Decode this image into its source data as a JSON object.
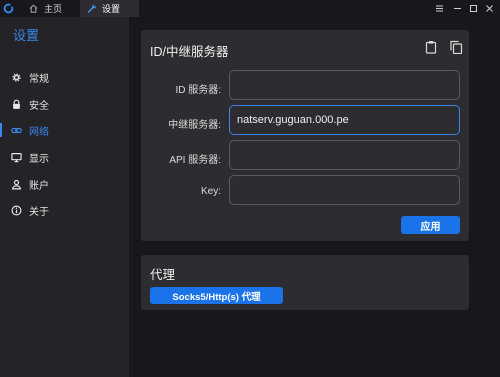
{
  "titlebar": {
    "logo_icon": "app-logo-icon",
    "tabs": [
      {
        "label": "主页",
        "icon": "home-icon"
      },
      {
        "label": "设置",
        "icon": "wrench-icon"
      }
    ],
    "controls": [
      "menu-icon",
      "minimize-icon",
      "maximize-icon",
      "close-icon"
    ]
  },
  "sidebar": {
    "title": "设置",
    "items": [
      {
        "label": "常规",
        "icon": "gear-icon"
      },
      {
        "label": "安全",
        "icon": "lock-icon"
      },
      {
        "label": "网络",
        "icon": "link-icon",
        "active": true
      },
      {
        "label": "显示",
        "icon": "monitor-icon"
      },
      {
        "label": "账户",
        "icon": "user-icon"
      },
      {
        "label": "关于",
        "icon": "info-icon"
      }
    ]
  },
  "id_server_card": {
    "title": "ID/中继服务器",
    "icons": [
      "clipboard-icon",
      "copy-icon"
    ],
    "fields": [
      {
        "label": "ID 服务器:",
        "value": ""
      },
      {
        "label": "中继服务器:",
        "value": "natserv.guguan.000.pe"
      },
      {
        "label": "API 服务器:",
        "value": ""
      },
      {
        "label": "Key:",
        "value": ""
      }
    ],
    "apply_label": "应用"
  },
  "proxy_card": {
    "title": "代理",
    "button_label": "Socks5/Http(s) 代理"
  },
  "colors": {
    "accent": "#3a86e8",
    "button": "#1a73e8",
    "background": "#18181c",
    "sidebar": "#232328",
    "card": "#2c2c31"
  }
}
